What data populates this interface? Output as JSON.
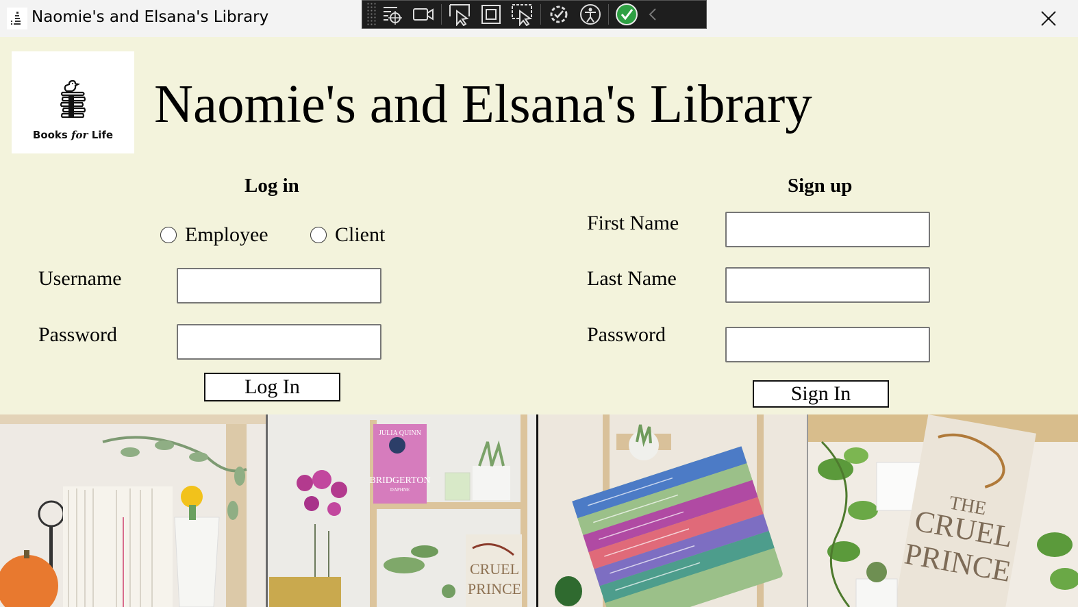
{
  "window": {
    "title": "Naomie's and Elsana's Library",
    "app_icon": "winforms-app-icon",
    "close_icon": "close-icon"
  },
  "devtools_toolbar": {
    "icons": [
      "select-element-icon",
      "video-capture-icon",
      "pointer-select-icon",
      "display-layout-adorners-icon",
      "track-focus-icon",
      "hot-reload-icon",
      "accessibility-icon",
      "binding-failures-ok-icon",
      "collapse-chevron-icon"
    ]
  },
  "header": {
    "logo_text_books": "Books",
    "logo_text_for": "for",
    "logo_text_life": "Life",
    "title": "Naomie's and Elsana's Library"
  },
  "login": {
    "heading": "Log in",
    "role_options": [
      "Employee",
      "Client"
    ],
    "username_label": "Username",
    "password_label": "Password",
    "username_value": "",
    "password_value": "",
    "submit_label": "Log In"
  },
  "signup": {
    "heading": "Sign up",
    "first_name_label": "First Name",
    "last_name_label": "Last Name",
    "password_label": "Password",
    "first_name_value": "",
    "last_name_value": "",
    "password_value": "",
    "submit_label": "Sign In"
  },
  "photo_strip": {
    "book_titles": {
      "bridgerton_author": "JULIA QUINN",
      "bridgerton_title": "BRIDGERTON",
      "bridgerton_subtitle": "DAPHNE",
      "cruel_prince_the": "THE",
      "cruel_prince_1": "CRUEL",
      "cruel_prince_2": "PRINCE"
    }
  },
  "colors": {
    "page_background": "#f3f3dc",
    "titlebar_background": "#f3f3f3",
    "devbar_background": "#1e1e1e",
    "check_green": "#2ea043"
  }
}
